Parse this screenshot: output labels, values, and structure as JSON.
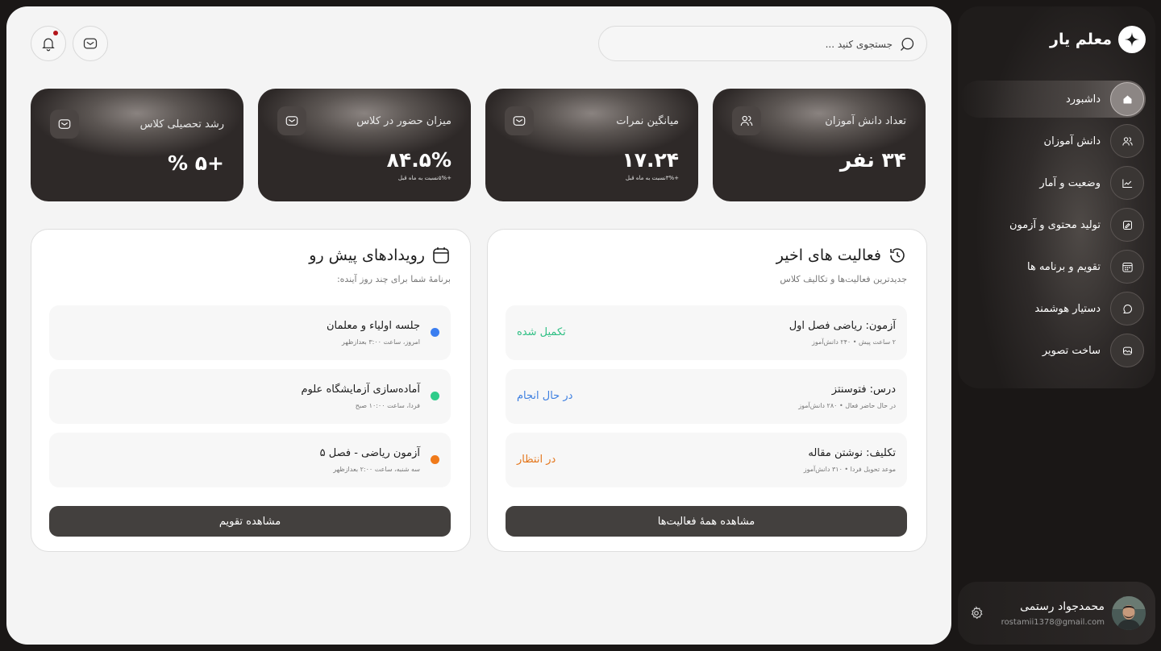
{
  "header": {
    "search_placeholder": "جستجوی کنید ...",
    "notification_dot_color": "#b3151b"
  },
  "stats": [
    {
      "label": "تعداد دانش آموزان",
      "value": "۳۴ نفر",
      "sub": "",
      "icon": "users-icon"
    },
    {
      "label": "میانگین نمرات",
      "value": "۱۷.۲۴",
      "sub": "+۳%نسبت به ماه قبل",
      "icon": "mail-icon"
    },
    {
      "label": "میزان حضور در کلاس",
      "value": "۸۴.۵%",
      "sub": "+۵%نسبت به ماه قبل",
      "icon": "mail-icon"
    },
    {
      "label": "رشد تحصیلی کلاس",
      "value": "+۵ %",
      "sub": "",
      "icon": "mail-icon"
    }
  ],
  "activities": {
    "title": "فعالیت های اخیر",
    "subtitle": "جدیدترین فعالیت‌ها و تکالیف کلاس",
    "items": [
      {
        "title": "آزمون: ریاضی فصل اول",
        "meta": "۲ ساعت پیش • ۲۴۰ دانش‌آموز",
        "status": "تکمیل شده",
        "status_color": "#2fbf84"
      },
      {
        "title": "درس: فتوسنتز",
        "meta": "در حال حاضر فعال • ۲۸۰ دانش‌آموز",
        "status": "در حال انجام",
        "status_color": "#3d7fe0"
      },
      {
        "title": "تکلیف: نوشتن مقاله",
        "meta": "موعد تحویل فردا • ۳۱۰ دانش‌آموز",
        "status": "در انتظار",
        "status_color": "#e4761b"
      }
    ],
    "button": "مشاهده همهٔ فعالیت‌ها"
  },
  "events": {
    "title": "رویدادهای پیش رو",
    "subtitle": "برنامهٔ شما برای چند روز آینده:",
    "items": [
      {
        "title": "جلسه اولیاء و معلمان",
        "meta": "امروز، ساعت ۳:۰۰ بعدازظهر",
        "dot_color": "#3b7ef0"
      },
      {
        "title": "آماده‌سازی آزمایشگاه علوم",
        "meta": "فردا، ساعت ۱۰:۰۰ صبح",
        "dot_color": "#2ecc8a"
      },
      {
        "title": "آزمون ریاضی - فصل ۵",
        "meta": "سه شنبه، ساعت ۲:۰۰ بعدازظهر",
        "dot_color": "#f07a1a"
      }
    ],
    "button": "مشاهده تقویم"
  },
  "sidebar": {
    "brand": "معلم یار",
    "items": [
      {
        "label": "داشبورد",
        "icon": "home-icon",
        "active": true
      },
      {
        "label": "دانش آموزان",
        "icon": "students-icon",
        "active": false
      },
      {
        "label": "وضعیت و آمار",
        "icon": "chart-icon",
        "active": false
      },
      {
        "label": "تولید محتوی و آزمون",
        "icon": "edit-icon",
        "active": false
      },
      {
        "label": "تقویم و برنامه ها",
        "icon": "calendar-icon",
        "active": false
      },
      {
        "label": "دستیار هوشمند",
        "icon": "chat-icon",
        "active": false
      },
      {
        "label": "ساخت تصویر",
        "icon": "image-icon",
        "active": false
      }
    ]
  },
  "profile": {
    "name": "محمدجواد رستمی",
    "email": "rostamii1378@gmail.com"
  }
}
